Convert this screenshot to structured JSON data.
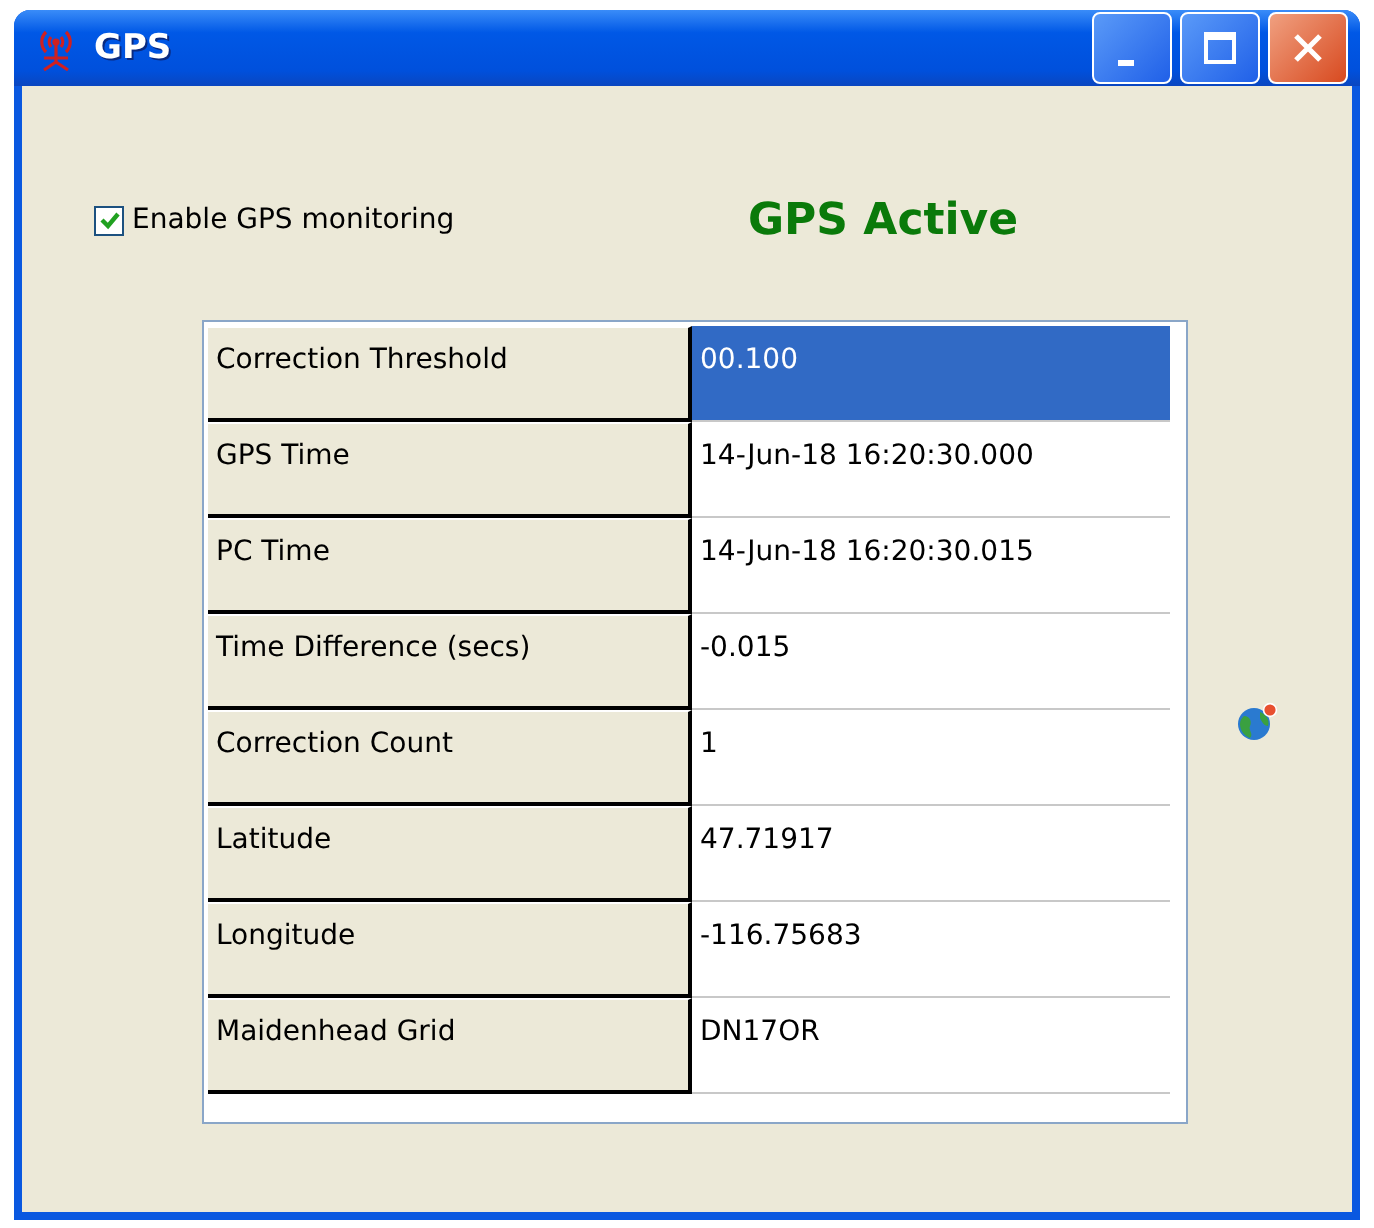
{
  "window": {
    "title": "GPS"
  },
  "enable_monitoring": {
    "label": "Enable GPS monitoring",
    "checked": true
  },
  "status": "GPS Active",
  "table": {
    "rows": [
      {
        "label": "Correction Threshold",
        "value": "00.100",
        "selected": true
      },
      {
        "label": "GPS Time",
        "value": "14-Jun-18 16:20:30.000",
        "selected": false
      },
      {
        "label": "PC Time",
        "value": "14-Jun-18 16:20:30.015",
        "selected": false
      },
      {
        "label": "Time Difference (secs)",
        "value": "-0.015",
        "selected": false
      },
      {
        "label": "Correction Count",
        "value": "1",
        "selected": false
      },
      {
        "label": "Latitude",
        "value": "47.71917",
        "selected": false
      },
      {
        "label": "Longitude",
        "value": "-116.75683",
        "selected": false
      },
      {
        "label": "Maidenhead Grid",
        "value": "DN17OR",
        "selected": false
      }
    ]
  }
}
